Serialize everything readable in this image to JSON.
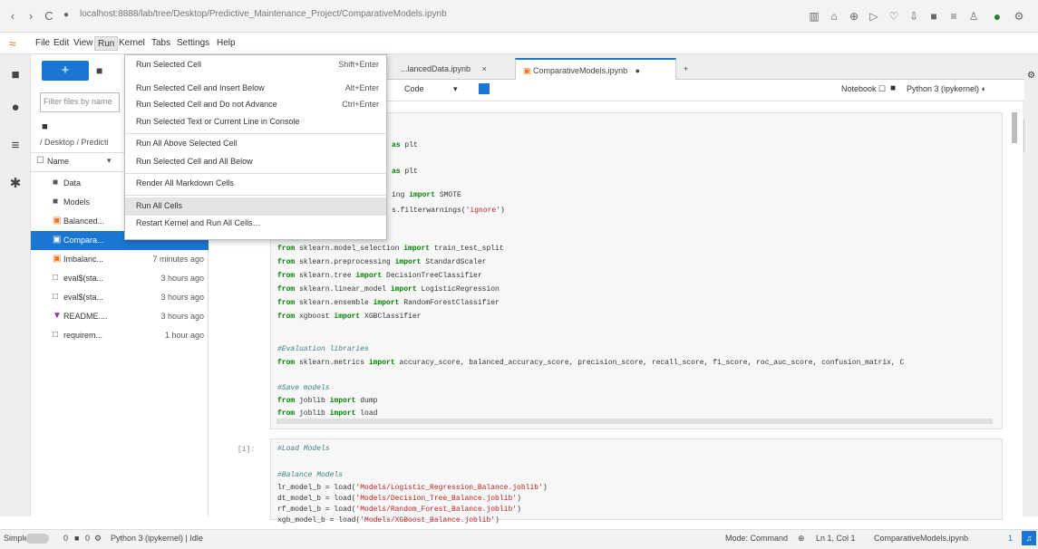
{
  "browser": {
    "url": "localhost:8888/lab/tree/Desktop/Predictive_Maintenance_Project/ComparativeModels.ipynb",
    "back": "‹",
    "forward": "›",
    "reload": "C"
  },
  "menubar": {
    "items": [
      "File",
      "Edit",
      "View",
      "Run",
      "Kernel",
      "Tabs",
      "Settings",
      "Help"
    ]
  },
  "run_menu": {
    "entries": [
      {
        "label": "Run Selected Cell",
        "shortcut": "Shift+Enter"
      },
      {
        "label": "Run Selected Cell and Insert Below",
        "shortcut": "Alt+Enter"
      },
      {
        "label": "Run Selected Cell and Do not Advance",
        "shortcut": "Ctrl+Enter"
      },
      {
        "label": "Run Selected Text or Current Line in Console",
        "shortcut": ""
      },
      {
        "label": "Run All Above Selected Cell",
        "shortcut": ""
      },
      {
        "label": "Run Selected Cell and All Below",
        "shortcut": ""
      },
      {
        "label": "Render All Markdown Cells",
        "shortcut": ""
      },
      {
        "label": "Run All Cells",
        "shortcut": ""
      },
      {
        "label": "Restart Kernel and Run All Cells…",
        "shortcut": ""
      }
    ]
  },
  "file_browser": {
    "new_button": "+",
    "filter_placeholder": "Filter files by name",
    "breadcrumb": "/ Desktop / Predicti",
    "column_name": "Name",
    "files": [
      {
        "name": "Data",
        "time": "",
        "icon": "■",
        "color": "#555"
      },
      {
        "name": "Models",
        "time": "",
        "icon": "■",
        "color": "#555"
      },
      {
        "name": "Balanced...",
        "time": "",
        "icon": "▣",
        "color": "#f37626"
      },
      {
        "name": "Compara...",
        "time": "",
        "icon": "▣",
        "color": "#f37626"
      },
      {
        "name": "Imbalanc...",
        "time": "7 minutes ago",
        "icon": "▣",
        "color": "#f37626"
      },
      {
        "name": "eval$(sta...",
        "time": "3 hours ago",
        "icon": "□",
        "color": "#555"
      },
      {
        "name": "eval$(sta...",
        "time": "3 hours ago",
        "icon": "□",
        "color": "#555"
      },
      {
        "name": "README....",
        "time": "3 hours ago",
        "icon": "▼",
        "color": "#9c27b0"
      },
      {
        "name": "requirem...",
        "time": "1 hour ago",
        "icon": "□",
        "color": "#555"
      }
    ]
  },
  "tabs": [
    {
      "label": "...lancedData.ipynb",
      "close": "×"
    },
    {
      "label": "ComparativeModels.ipynb",
      "close": "●"
    }
  ],
  "toolbar": {
    "cell_type": "Code",
    "notebook_label": "Notebook",
    "kernel": "Python 3 (ipykernel)"
  },
  "cells": {
    "first_lines": [
      {
        "pre": "",
        "kw": "as",
        "post": " plt",
        "indent": "                    "
      },
      {
        "pre": "",
        "kw": "as",
        "post": " plt",
        "indent": "                    "
      },
      {
        "pre": "ing ",
        "kw": "import",
        "post": " SMOTE",
        "indent": "                    "
      },
      {
        "pre": "s.filterwarnings(",
        "kw": "",
        "post": "'ignore')",
        "indent": "                    "
      }
    ],
    "imports": [
      "from sklearn.model_selection import train_test_split",
      "from sklearn.preprocessing import StandardScaler",
      "from sklearn.tree import DecisionTreeClassifier",
      "from sklearn.linear_model import LogisticRegression",
      "from sklearn.ensemble import RandomForestClassifier",
      "from xgboost import XGBClassifier"
    ],
    "eval_comment": "#Evaluation libraries",
    "eval_import": "from sklearn.metrics import accuracy_score, balanced_accuracy_score, precision_score, recall_score, f1_score, roc_auc_score, confusion_matrix, C",
    "save_comment": "#Save models",
    "save_lines": [
      "from joblib import dump",
      "from joblib import load"
    ],
    "prompt2": "[1]:",
    "load_comment": "#Load Models",
    "balance_comment": "#Balance Models",
    "load_lines": [
      "lr_model_b = load('Models/Logistic_Regression_Balance.joblib')",
      "dt_model_b = load('Models/Decision_Tree_Balance.joblib')",
      "rf_model_b = load('Models/Random_Forest_Balance.joblib')",
      "xgb_model_b = load('Models/XGBoost_Balance.joblib')"
    ]
  },
  "status": {
    "simple": "Simple",
    "counts": "0",
    "kernel_status": "Python 3 (ipykernel) | Idle",
    "mode": "Mode: Command",
    "position": "Ln 1, Col 1",
    "filename": "ComparativeModels.ipynb",
    "notif": "1"
  }
}
